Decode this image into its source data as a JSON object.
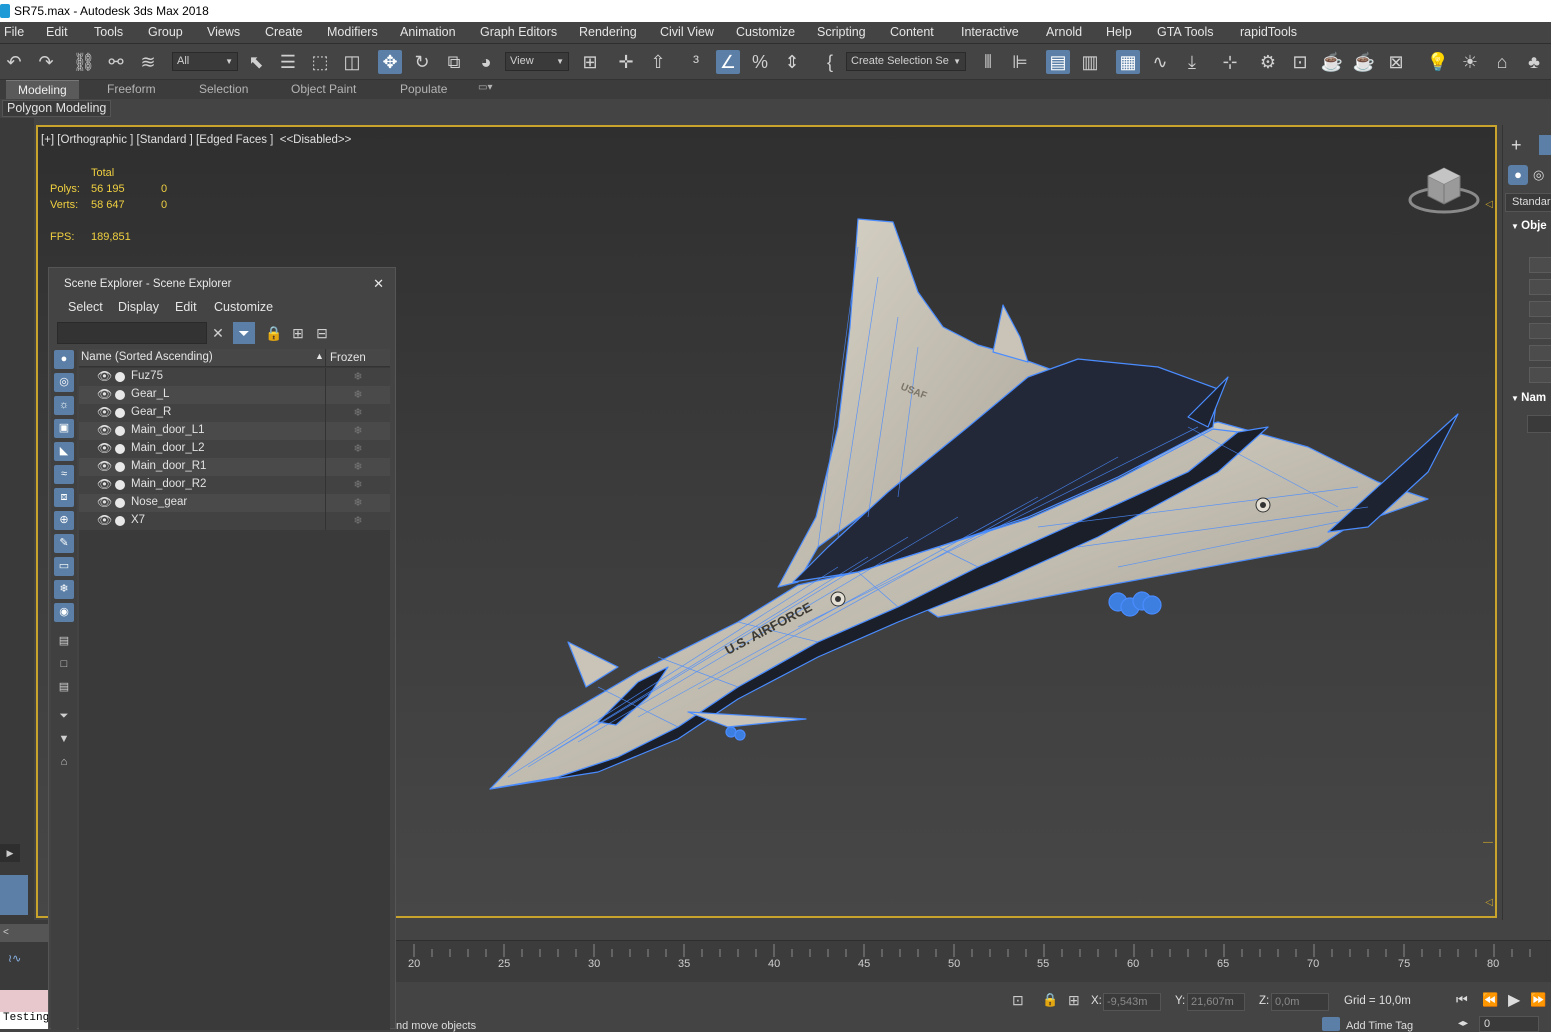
{
  "window": {
    "title": "SR75.max - Autodesk 3ds Max 2018"
  },
  "menu": [
    "File",
    "Edit",
    "Tools",
    "Group",
    "Views",
    "Create",
    "Modifiers",
    "Animation",
    "Graph Editors",
    "Rendering",
    "Civil View",
    "Customize",
    "Scripting",
    "Content",
    "Interactive",
    "Arnold",
    "Help",
    "GTA Tools",
    "rapidTools"
  ],
  "toolbar": {
    "filter_value": "All",
    "ref_coord_value": "View",
    "selection_set_value": "Create Selection Se"
  },
  "ribbon": {
    "tabs": [
      "Modeling",
      "Freeform",
      "Selection",
      "Object Paint",
      "Populate"
    ],
    "active_tab": "Modeling",
    "panel_label": "Polygon Modeling"
  },
  "viewport": {
    "label": "[+] [Orthographic ] [Standard ] [Edged Faces ]  <<Disabled>>",
    "stats": {
      "total_label": "Total",
      "polys_label": "Polys:",
      "polys_total": "56 195",
      "polys_sel": "0",
      "verts_label": "Verts:",
      "verts_total": "58 647",
      "verts_sel": "0",
      "fps_label": "FPS:",
      "fps_value": "189,851"
    },
    "decals": {
      "wing": "USAF",
      "fuselage": "U.S. AIRFORCE"
    }
  },
  "scene_explorer": {
    "title": "Scene Explorer - Scene Explorer",
    "menu": [
      "Select",
      "Display",
      "Edit",
      "Customize"
    ],
    "column_name": "Name (Sorted Ascending)",
    "column_frozen": "Frozen",
    "objects": [
      "Fuz75",
      "Gear_L",
      "Gear_R",
      "Main_door_L1",
      "Main_door_L2",
      "Main_door_R1",
      "Main_door_R2",
      "Nose_gear",
      "X7"
    ]
  },
  "command_panel": {
    "dropdown": "Standard",
    "rollout_object": "Obje",
    "rollout_name": "Nam"
  },
  "timeline": {
    "ticks": [
      "20",
      "25",
      "30",
      "35",
      "40",
      "45",
      "50",
      "55",
      "60",
      "65",
      "70",
      "75",
      "80"
    ]
  },
  "status": {
    "x_label": "X:",
    "x_value": "-9,543m",
    "y_label": "Y:",
    "y_value": "21,607m",
    "z_label": "Z:",
    "z_value": "0,0m",
    "grid": "Grid = 10,0m",
    "prompt": "nd move objects",
    "add_time_tag": "Add Time Tag",
    "frame_value": "0",
    "maxscript_listener": "Testing"
  },
  "colors": {
    "accent": "#5b7fa6",
    "viewport_border": "#c8a42c",
    "stats_yellow": "#f0d040",
    "wire": "#4a8cff"
  }
}
